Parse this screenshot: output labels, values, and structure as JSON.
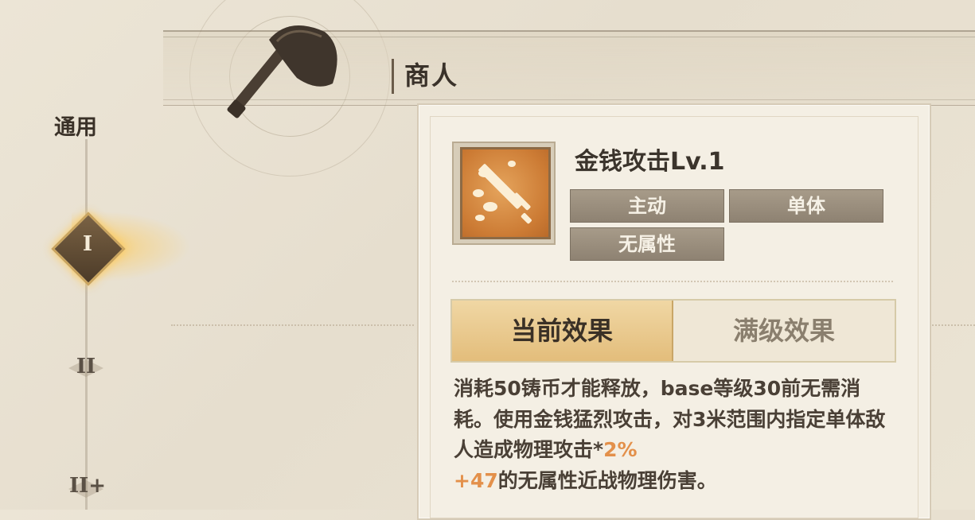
{
  "header": {
    "class_title": "商人"
  },
  "sidebar": {
    "category_label": "通用",
    "tiers": [
      {
        "label": "I",
        "active": true
      },
      {
        "label": "II",
        "active": false
      },
      {
        "label": "II+",
        "active": false
      }
    ]
  },
  "skill": {
    "name": "金钱攻击Lv.1",
    "icon": "sword-and-coins-icon",
    "tags": [
      "主动",
      "单体",
      "无属性"
    ]
  },
  "tabs": {
    "current_label": "当前效果",
    "max_label": "满级效果",
    "active": "current"
  },
  "description": {
    "part1": "消耗50铸币才能释放，base等级30前无需消耗。使用金钱猛烈攻击，对3米范围内指定单体敌人造成物理攻击*",
    "highlight1": "2%",
    "highlight2": "+47",
    "part2": "的无属性近战物理伤害。"
  },
  "colors": {
    "accent": "#e3904a",
    "tab_active": "#e3bd7b",
    "tag_bg": "#9a8e7d",
    "glow": "#ffcf5a"
  }
}
